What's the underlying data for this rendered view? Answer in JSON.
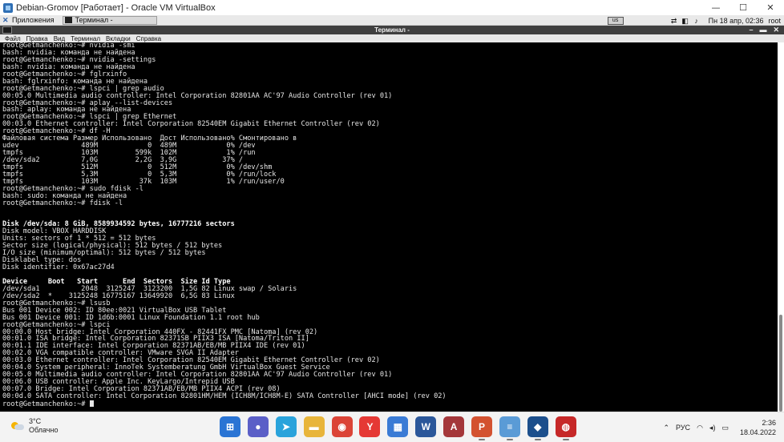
{
  "host": {
    "title": "Debian-Gromov [Работает] - Oracle VM VirtualBox",
    "controls": {
      "minimize": "—",
      "maximize": "☐",
      "close": "✕"
    }
  },
  "guest_panel": {
    "apps_label": "Приложения",
    "task_label": "Терминал -",
    "keyboard_indicator": "us",
    "clock": "Пн 18 апр, 02:36",
    "clock_suffix": "root"
  },
  "terminal": {
    "title": "Терминал -",
    "controls": {
      "minimize": "–",
      "maximize": "▬",
      "close": "✕"
    },
    "menu": [
      "Файл",
      "Правка",
      "Вид",
      "Терминал",
      "Вкладки",
      "Справка"
    ],
    "lines": [
      "root@Getmanchenko:~# nvidia -smi",
      "bash: nvidia: команда не найдена",
      "root@Getmanchenko:~# nvidia -settings",
      "bash: nvidia: команда не найдена",
      "root@Getmanchenko:~# fglrxinfo",
      "bash: fglrxinfo: команда не найдена",
      "root@Getmanchenko:~# lspci | grep audio",
      "00:05.0 Multimedia audio controller: Intel Corporation 82801AA AC'97 Audio Controller (rev 01)",
      "root@Getmanchenko:~# aplay --list-devices",
      "bash: aplay: команда не найдена",
      "root@Getmanchenko:~# lspci | grep Ethernet",
      "00:03.0 Ethernet controller: Intel Corporation 82540EM Gigabit Ethernet Controller (rev 02)",
      "root@Getmanchenko:~# df -H",
      "Файловая система Размер Использовано  Дост Использовано% Смонтировано в",
      "udev               489M            0  489M            0% /dev",
      "tmpfs              103M         599k  102M            1% /run",
      "/dev/sda2          7,0G         2,2G  3,9G           37% /",
      "tmpfs              512M            0  512M            0% /dev/shm",
      "tmpfs              5,3M            0  5,3M            0% /run/lock",
      "tmpfs              103M          37k  103M            1% /run/user/0",
      "root@Getmanchenko:~# sudo fdisk -l",
      "bash: sudo: команда не найдена",
      "root@Getmanchenko:~# fdisk -l",
      "",
      "",
      "Disk /dev/sda: 8 GiB, 8589934592 bytes, 16777216 sectors",
      "Disk model: VBOX HARDDISK",
      "Units: sectors of 1 * 512 = 512 bytes",
      "Sector size (logical/physical): 512 bytes / 512 bytes",
      "I/O size (minimum/optimal): 512 bytes / 512 bytes",
      "Disklabel type: dos",
      "Disk identifier: 0x67ac27d4",
      "",
      "Device     Boot   Start      End  Sectors  Size Id Type",
      "/dev/sda1          2048  3125247  3123200  1,5G 82 Linux swap / Solaris",
      "/dev/sda2  *    3125248 16775167 13649920  6,5G 83 Linux",
      "root@Getmanchenko:~# lsusb",
      "Bus 001 Device 002: ID 80ee:0021 VirtualBox USB Tablet",
      "Bus 001 Device 001: ID 1d6b:0001 Linux Foundation 1.1 root hub",
      "root@Getmanchenko:~# lspci",
      "00:00.0 Host bridge: Intel Corporation 440FX - 82441FX PMC [Natoma] (rev 02)",
      "00:01.0 ISA bridge: Intel Corporation 82371SB PIIX3 ISA [Natoma/Triton II]",
      "00:01.1 IDE interface: Intel Corporation 82371AB/EB/MB PIIX4 IDE (rev 01)",
      "00:02.0 VGA compatible controller: VMware SVGA II Adapter",
      "00:03.0 Ethernet controller: Intel Corporation 82540EM Gigabit Ethernet Controller (rev 02)",
      "00:04.0 System peripheral: InnoTek Systemberatung GmbH VirtualBox Guest Service",
      "00:05.0 Multimedia audio controller: Intel Corporation 82801AA AC'97 Audio Controller (rev 01)",
      "00:06.0 USB controller: Apple Inc. KeyLargo/Intrepid USB",
      "00:07.0 Bridge: Intel Corporation 82371AB/EB/MB PIIX4 ACPI (rev 08)",
      "00:0d.0 SATA controller: Intel Corporation 82801HM/HEM (ICH8M/ICH8M-E) SATA Controller [AHCI mode] (rev 02)"
    ],
    "bold_lines": [
      25,
      33
    ],
    "prompt": "root@Getmanchenko:~# "
  },
  "taskbar": {
    "weather_temp": "3°C",
    "weather_desc": "Облачно",
    "language": "РУС",
    "time": "2:36",
    "date": "18.04.2022",
    "apps": [
      {
        "name": "windows-start",
        "glyph": "⊞",
        "color": "#2a74d4"
      },
      {
        "name": "chat",
        "glyph": "●",
        "color": "#5b5fc7"
      },
      {
        "name": "telegram",
        "glyph": "➤",
        "color": "#2aa3db"
      },
      {
        "name": "file-explorer",
        "glyph": "▬",
        "color": "#e8b53a"
      },
      {
        "name": "chrome",
        "glyph": "◉",
        "color": "#db4437"
      },
      {
        "name": "yandex",
        "glyph": "Y",
        "color": "#e53935"
      },
      {
        "name": "store",
        "glyph": "▦",
        "color": "#3a7bd5"
      },
      {
        "name": "word",
        "glyph": "W",
        "color": "#2b579a"
      },
      {
        "name": "access",
        "glyph": "A",
        "color": "#a4373a"
      },
      {
        "name": "powerpoint",
        "glyph": "P",
        "color": "#d35230"
      },
      {
        "name": "notepad",
        "glyph": "≡",
        "color": "#5a9bd6"
      },
      {
        "name": "virtualbox",
        "glyph": "◆",
        "color": "#1c4f8c"
      },
      {
        "name": "app-red",
        "glyph": "◍",
        "color": "#c62828"
      }
    ]
  }
}
